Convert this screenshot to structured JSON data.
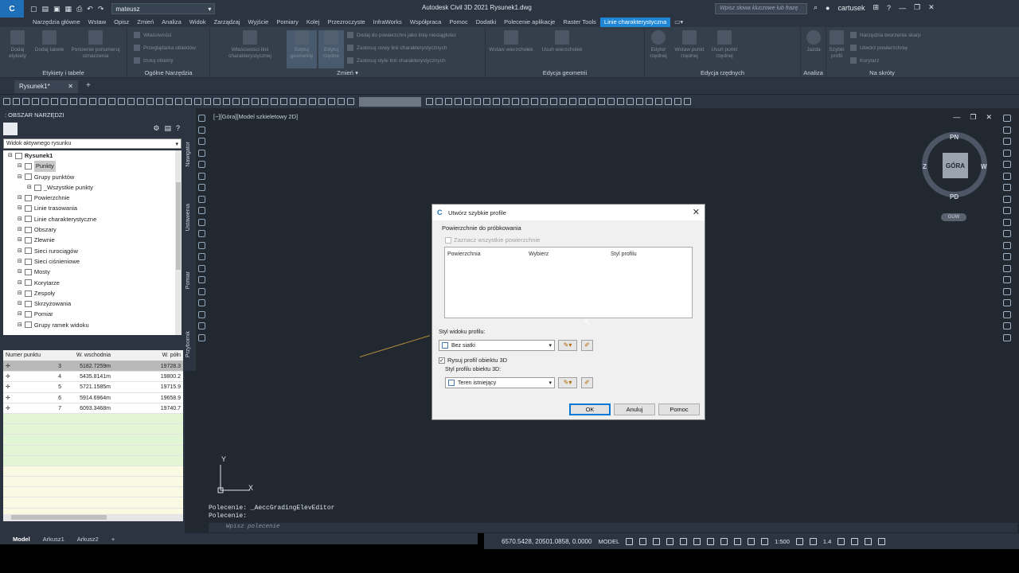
{
  "app": {
    "logo_text": "C",
    "title": "Autodesk Civil 3D 2021    Rysunek1.dwg",
    "workspace": "mateusz",
    "search_placeholder": "Wpisz słowa kluczowe lub frazę",
    "user": "cartusek"
  },
  "menu": [
    "Narzędzia główne",
    "Wstaw",
    "Opisz",
    "Zmień",
    "Analiza",
    "Widok",
    "Zarządzaj",
    "Wyjście",
    "Pomiary",
    "Kolej",
    "Przezroczyste",
    "InfraWorks",
    "Współpraca",
    "Pomoc",
    "Dodatki",
    "Polecenie aplikacje",
    "Raster Tools",
    "Linie charakterystyczna"
  ],
  "ribbon": {
    "groups": {
      "etykiety": "Etykiety i tabele",
      "ogolne": "Ogólne Narzędzia",
      "zmien": "Zmień",
      "edycja_geom": "Edycja geometrii",
      "edycja_rzednych": "Edycja rzędnych",
      "analiza": "Analiza",
      "na_skroty": "Na skróty"
    },
    "buttons": {
      "dodaj_etykiety": "Dodaj etykiety",
      "dodaj_tabele": "Dodaj tabele",
      "ponowne": "Ponownie ponumeruj oznaczenia",
      "wlasciwosci": "Właściwości",
      "przegladarka": "Przeglądarka obiektów",
      "izoluj": "Izoluj obiekty",
      "wlasciwosci_linii": "Właściwości linii charakterystycznej",
      "edytuj_geom": "Edytuj geometrię",
      "edytuj_rzed": "Edytuj rzędne",
      "dodaj_do_pow": "Dodaj do powierzchni jako linię nieciągłości",
      "zastosuj_nowy": "Zastosuj nowy linii charakterystycznych",
      "zastosuj_style": "Zastosuj style linii charakterystycznych",
      "wstaw_wierzch": "Wstaw wierzchołek",
      "usun_wierzch": "Usuń wierzchołek",
      "edytor_rzed": "Edytor rzędnej",
      "wstaw_punkt": "Wstaw punkt rzędnej",
      "usun_punkt": "Usuń punkt rzędnej",
      "jazda": "Jazda",
      "szybki_profil": "Szybki profil",
      "narzedzia_skarp": "Narzędzia tworzenia skarp",
      "utworz_pow": "Utwórz powierzchnię",
      "korytarz": "Korytarz"
    }
  },
  "doc_tab": "Rysunek1*",
  "toolspace": {
    "header": "OBSZAR NARZĘDZI",
    "view_select": "Widok aktywnego rysunku",
    "tree": [
      {
        "label": "Rysunek1",
        "indent": 0,
        "bold": true
      },
      {
        "label": "Punkty",
        "indent": 1,
        "selected": true
      },
      {
        "label": "Grupy punktów",
        "indent": 1
      },
      {
        "label": "_Wszystkie punkty",
        "indent": 2
      },
      {
        "label": "Powierzchnie",
        "indent": 1
      },
      {
        "label": "Linie trasowania",
        "indent": 1
      },
      {
        "label": "Linie charakterystyczne",
        "indent": 1
      },
      {
        "label": "Obszary",
        "indent": 1
      },
      {
        "label": "Zlewnie",
        "indent": 1
      },
      {
        "label": "Sieci rurociągów",
        "indent": 1
      },
      {
        "label": "Sieci ciśnieniowe",
        "indent": 1
      },
      {
        "label": "Mosty",
        "indent": 1
      },
      {
        "label": "Korytarze",
        "indent": 1
      },
      {
        "label": "Zespoły",
        "indent": 1
      },
      {
        "label": "Skrzyżowania",
        "indent": 1
      },
      {
        "label": "Pomiar",
        "indent": 1
      },
      {
        "label": "Grupy ramek widoku",
        "indent": 1
      }
    ],
    "vtabs": [
      "Nawigator",
      "Ustawienia",
      "Pomiar",
      "Przybornik"
    ],
    "grid": {
      "headers": [
        "Numer punktu",
        "W. wschodnia",
        "W. półn"
      ],
      "rows": [
        {
          "num": "3",
          "east": "5182.7259m",
          "north": "19728.3",
          "selected": true
        },
        {
          "num": "4",
          "east": "5435.8141m",
          "north": "19800.2"
        },
        {
          "num": "5",
          "east": "5721.1585m",
          "north": "19715.9"
        },
        {
          "num": "6",
          "east": "5914.6964m",
          "north": "19658.9"
        },
        {
          "num": "7",
          "east": "6093.3468m",
          "north": "19740.7"
        }
      ]
    }
  },
  "viewport": {
    "label": "[−][Góra][Model szkieletowy 2D]",
    "viewcube": {
      "top": "GÓRA",
      "n": "PN",
      "s": "PD",
      "e": "W",
      "w": "Z",
      "ucs": "GUW"
    },
    "ucs_x": "X",
    "ucs_y": "Y"
  },
  "dialog": {
    "title": "Utwórz szybkie profile",
    "section_surfaces": "Powierzchnie do próbkowania",
    "select_all": "Zaznacz wszystkie powierzchnie",
    "col_surface": "Powierzchnia",
    "col_select": "Wybierz",
    "col_style": "Styl profilu",
    "view_style_label": "Styl widoku profilu:",
    "view_style_value": "Bez siatki",
    "draw_3d": "Rysuj profil obiektu 3D",
    "style_3d_label": "Styl profilu obiektu 3D:",
    "style_3d_value": "Teren istniejący",
    "ok": "OK",
    "cancel": "Anuluj",
    "help": "Pomoc"
  },
  "command": {
    "history": [
      "Polecenie:  _AeccGradingElevEditor",
      "Polecenie:"
    ],
    "placeholder": "Wpisz polecenie"
  },
  "layouts": [
    "Model",
    "Arkusz1",
    "Arkusz2"
  ],
  "status": {
    "coords": "6570.5428, 20501.0858, 0.0000",
    "model": "MODEL",
    "scale": "1:500",
    "num": "1.4"
  }
}
